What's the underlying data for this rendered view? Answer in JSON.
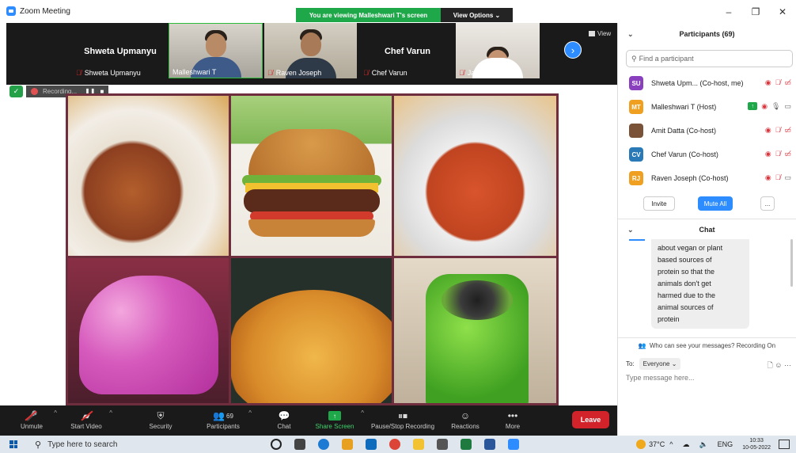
{
  "window": {
    "title": "Zoom Meeting",
    "viewing_banner": "You are viewing Malleshwari T's screen",
    "view_options": "View Options ⌄",
    "controls": [
      "–",
      "❐",
      "✕"
    ]
  },
  "thumbnails": [
    {
      "big_name": "Shweta Upmanyu",
      "label": "Shweta Upmanyu",
      "muted": true,
      "video": false
    },
    {
      "big_name": "",
      "label": "Malleshwari T",
      "muted": false,
      "video": true,
      "active": true
    },
    {
      "big_name": "",
      "label": "Raven Joseph",
      "muted": true,
      "video": true
    },
    {
      "big_name": "Chef Varun",
      "label": "Chef Varun",
      "muted": true,
      "video": false
    },
    {
      "big_name": "",
      "label": "Jagriti Tiwari",
      "muted": true,
      "video": true
    }
  ],
  "strip_view_label": "View",
  "recording": {
    "text": "Recording...",
    "pause": "❚❚",
    "stop": "■"
  },
  "toolbar": {
    "unmute": "Unmute",
    "start_video": "Start Video",
    "security": "Security",
    "participants": "Participants",
    "participants_count": "69",
    "chat": "Chat",
    "share_screen": "Share Screen",
    "pause_stop_recording": "Pause/Stop Recording",
    "reactions": "Reactions",
    "more": "More",
    "leave": "Leave"
  },
  "participants_panel": {
    "title": "Participants (69)",
    "search_placeholder": "Find a participant",
    "list": [
      {
        "initials": "SU",
        "color": "#8a3fbf",
        "name": "Shweta Upm... (Co-host, me)"
      },
      {
        "initials": "MT",
        "color": "#f0a020",
        "name": "Malleshwari T (Host)"
      },
      {
        "initials": "",
        "color": "#7a5238",
        "name": "Amit Datta (Co-host)"
      },
      {
        "initials": "CV",
        "color": "#2a7ab8",
        "name": "Chef Varun (Co-host)"
      },
      {
        "initials": "RJ",
        "color": "#f0a020",
        "name": "Raven Joseph (Co-host)"
      }
    ],
    "invite": "Invite",
    "mute_all": "Mute All",
    "more": "..."
  },
  "chat_panel": {
    "title": "Chat",
    "message_lines": [
      "about vegan or plant",
      "based sources of",
      "protein so that the",
      "animals don't get",
      "harmed due to the",
      "animal sources of",
      "protein"
    ],
    "notice": "Who can see your messages? Recording On",
    "to_label": "To:",
    "to_value": "Everyone ⌄",
    "input_placeholder": "Type message here..."
  },
  "taskbar": {
    "search_placeholder": "Type here to search",
    "weather": "37°C",
    "lang": "ENG",
    "time": "10:33",
    "date": "10-05-2022"
  },
  "colors": {
    "zoom_blue": "#2d8cff",
    "share_green": "#1fa84a",
    "leave_red": "#d2232a",
    "collage_border": "#6e2e3e"
  }
}
